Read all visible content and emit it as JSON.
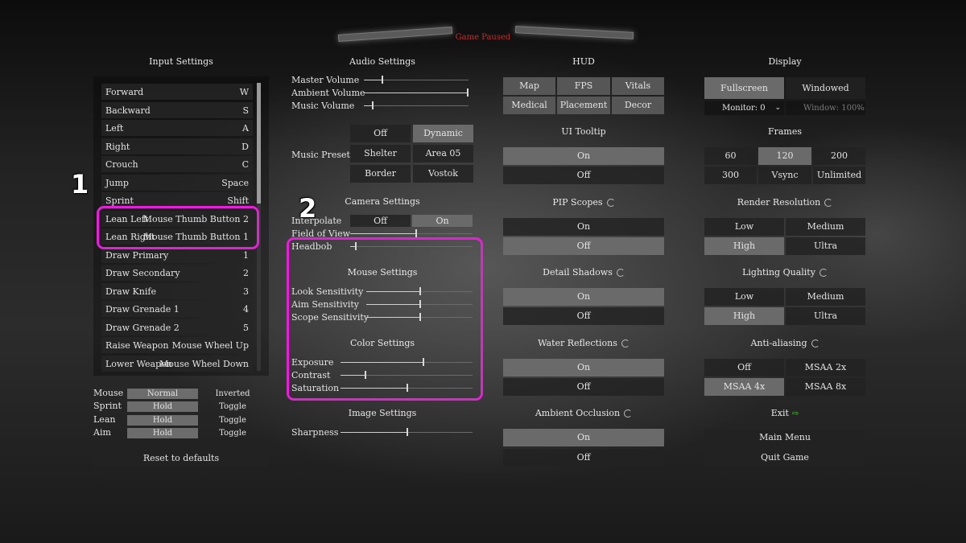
{
  "header": {
    "paused": "Game Paused"
  },
  "input": {
    "title": "Input Settings",
    "bindings": [
      {
        "name": "Forward",
        "key": "W"
      },
      {
        "name": "Backward",
        "key": "S"
      },
      {
        "name": "Left",
        "key": "A"
      },
      {
        "name": "Right",
        "key": "D"
      },
      {
        "name": "Crouch",
        "key": "C"
      },
      {
        "name": "Jump",
        "key": "Space"
      },
      {
        "name": "Sprint",
        "key": "Shift"
      },
      {
        "name": "Lean Left",
        "key": "Mouse Thumb Button 2"
      },
      {
        "name": "Lean Right",
        "key": "Mouse Thumb Button 1"
      },
      {
        "name": "Draw Primary",
        "key": "1"
      },
      {
        "name": "Draw Secondary",
        "key": "2"
      },
      {
        "name": "Draw Knife",
        "key": "3"
      },
      {
        "name": "Draw Grenade 1",
        "key": "4"
      },
      {
        "name": "Draw Grenade 2",
        "key": "5"
      },
      {
        "name": "Raise Weapon",
        "key": "Mouse Wheel Up"
      },
      {
        "name": "Lower Weapon",
        "key": "Mouse Wheel Down"
      }
    ],
    "options": [
      {
        "label": "Mouse",
        "a": "Normal",
        "b": "Inverted",
        "selected": "a"
      },
      {
        "label": "Sprint",
        "a": "Hold",
        "b": "Toggle",
        "selected": "a"
      },
      {
        "label": "Lean",
        "a": "Hold",
        "b": "Toggle",
        "selected": "a"
      },
      {
        "label": "Aim",
        "a": "Hold",
        "b": "Toggle",
        "selected": "a"
      }
    ],
    "reset": "Reset to defaults"
  },
  "audio": {
    "title": "Audio Settings",
    "master": {
      "label": "Master Volume",
      "value": 0.17
    },
    "ambient": {
      "label": "Ambient Volume",
      "value": 1.0
    },
    "music": {
      "label": "Music Volume",
      "value": 0.08
    },
    "preset_label": "Music Preset",
    "presets": [
      "Off",
      "Dynamic",
      "Shelter",
      "Area 05",
      "Border",
      "Vostok"
    ],
    "preset_selected": "Dynamic"
  },
  "camera": {
    "title": "Camera Settings",
    "interpolate": {
      "label": "Interpolate",
      "off": "Off",
      "on": "On",
      "selected": "On"
    },
    "fov": {
      "label": "Field of View",
      "value": 0.53
    },
    "headbob": {
      "label": "Headbob",
      "value": 0.04
    }
  },
  "mouse": {
    "title": "Mouse Settings",
    "look": {
      "label": "Look Sensitivity",
      "value": 0.5
    },
    "aim": {
      "label": "Aim Sensitivity",
      "value": 0.5
    },
    "scope": {
      "label": "Scope Sensitivity",
      "value": 0.5
    }
  },
  "color": {
    "title": "Color Settings",
    "exposure": {
      "label": "Exposure",
      "value": 0.62
    },
    "contrast": {
      "label": "Contrast",
      "value": 0.18
    },
    "saturation": {
      "label": "Saturation",
      "value": 0.5
    }
  },
  "image": {
    "title": "Image Settings",
    "sharpness": {
      "label": "Sharpness",
      "value": 0.5
    }
  },
  "hud": {
    "title": "HUD",
    "buttons": [
      "Map",
      "FPS",
      "Vitals",
      "Medical",
      "Placement",
      "Decor"
    ],
    "tooltip_title": "UI Tooltip",
    "pip_title": "PIP Scopes",
    "shadows_title": "Detail Shadows",
    "water_title": "Water Reflections",
    "ao_title": "Ambient Occlusion",
    "on": "On",
    "off": "Off"
  },
  "display": {
    "title": "Display",
    "fullscreen": "Fullscreen",
    "windowed": "Windowed",
    "monitor": "Monitor: 0",
    "window": "Window: 100%",
    "frames_title": "Frames",
    "frames": [
      "60",
      "120",
      "200",
      "300",
      "Vsync",
      "Unlimited"
    ],
    "frames_selected": "120",
    "render_title": "Render Resolution",
    "render": [
      "Low",
      "Medium",
      "High",
      "Ultra"
    ],
    "render_selected": "High",
    "lighting_title": "Lighting Quality",
    "lighting": [
      "Low",
      "Medium",
      "High",
      "Ultra"
    ],
    "lighting_selected": "High",
    "aa_title": "Anti-aliasing",
    "aa": [
      "Off",
      "MSAA 2x",
      "MSAA 4x",
      "MSAA 8x"
    ],
    "aa_selected": "MSAA 4x",
    "exit_title": "Exit",
    "main_menu": "Main Menu",
    "quit": "Quit Game"
  },
  "annotations": {
    "one": "1",
    "two": "2"
  },
  "colors": {
    "highlight": "#e81edb",
    "paused": "#c42c2c",
    "selected": "#6c6c6c"
  }
}
